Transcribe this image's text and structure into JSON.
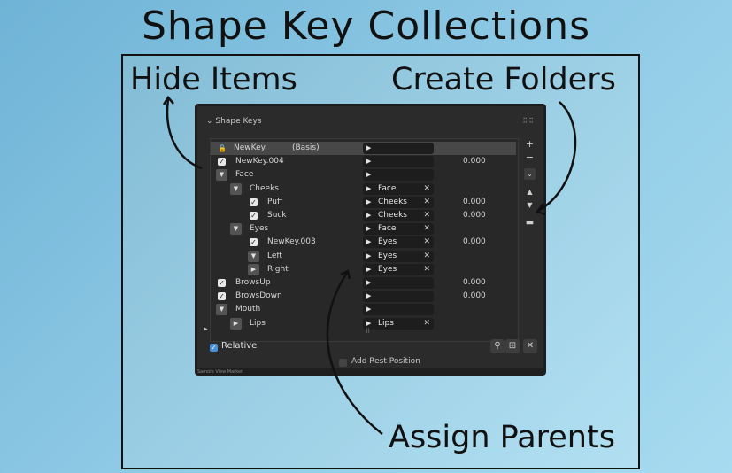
{
  "title": "Shape Key Collections",
  "callouts": {
    "hide": "Hide Items",
    "create": "Create Folders",
    "assign": "Assign Parents"
  },
  "panel": {
    "header": "Shape Keys",
    "rows": [
      {
        "name": "NewKey",
        "extra": "(Basis)",
        "parent": "",
        "value": "",
        "control": "lock",
        "selected": true
      },
      {
        "name": "NewKey.004",
        "parent": "",
        "value": "0.000",
        "control": "check"
      },
      {
        "name": "Face",
        "parent": "",
        "value": "",
        "control": "folder-open"
      },
      {
        "name": "Cheeks",
        "parent": "Face",
        "value": "",
        "control": "folder-open"
      },
      {
        "name": "Puff",
        "parent": "Cheeks",
        "value": "0.000",
        "control": "check"
      },
      {
        "name": "Suck",
        "parent": "Cheeks",
        "value": "0.000",
        "control": "check"
      },
      {
        "name": "Eyes",
        "parent": "Face",
        "value": "",
        "control": "folder-open"
      },
      {
        "name": "NewKey.003",
        "parent": "Eyes",
        "value": "0.000",
        "control": "check"
      },
      {
        "name": "Left",
        "parent": "Eyes",
        "value": "",
        "control": "folder-open"
      },
      {
        "name": "Right",
        "parent": "Eyes",
        "value": "",
        "control": "folder-closed"
      },
      {
        "name": "BrowsUp",
        "parent": "",
        "value": "0.000",
        "control": "check"
      },
      {
        "name": "BrowsDown",
        "parent": "",
        "value": "0.000",
        "control": "check"
      },
      {
        "name": "Mouth",
        "parent": "",
        "value": "",
        "control": "folder-open"
      },
      {
        "name": "Lips",
        "parent": "Lips",
        "value": "",
        "control": "folder-closed"
      }
    ],
    "relative_label": "Relative",
    "add_rest_label": "Add Rest Position",
    "status_bar": "Sample   View   Marker"
  },
  "icons": {
    "lock": "lock-icon",
    "add": "plus-icon",
    "remove": "minus-icon",
    "menu": "chevron-down-icon",
    "up": "arrow-up-icon",
    "down": "arrow-down-icon",
    "folder": "folder-icon",
    "pin": "pin-icon",
    "close": "close-icon"
  }
}
